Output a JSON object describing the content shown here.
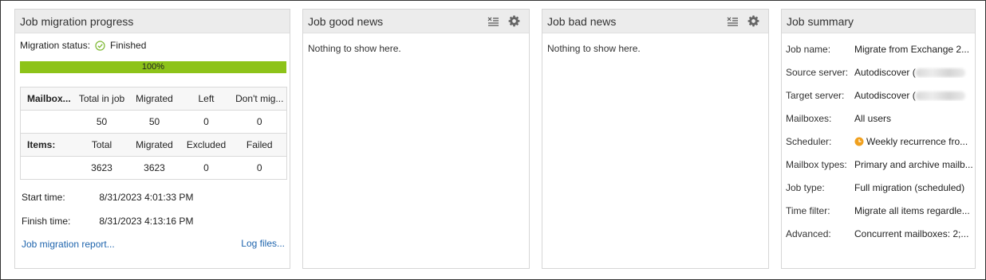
{
  "migration": {
    "title": "Job migration progress",
    "status_label": "Migration status:",
    "status_value": "Finished",
    "progress_fraction": 1.0,
    "progress_text": "100%",
    "mailbox_header": [
      "Mailbox...",
      "Total in job",
      "Migrated",
      "Left",
      "Don't mig..."
    ],
    "mailbox_values": [
      "",
      "50",
      "50",
      "0",
      "0"
    ],
    "items_header": [
      "Items:",
      "Total",
      "Migrated",
      "Excluded",
      "Failed"
    ],
    "items_values": [
      "",
      "3623",
      "3623",
      "0",
      "0"
    ],
    "start_label": "Start time:",
    "start_value": "8/31/2023 4:01:33 PM",
    "finish_label": "Finish time:",
    "finish_value": "8/31/2023 4:13:16 PM",
    "report_link": "Job migration report...",
    "log_link": "Log files..."
  },
  "good_news": {
    "title": "Job good news",
    "message": "Nothing to show here."
  },
  "bad_news": {
    "title": "Job bad news",
    "message": "Nothing to show here."
  },
  "summary": {
    "title": "Job summary",
    "rows": [
      {
        "label": "Job name:",
        "value": "Migrate from Exchange 2..."
      },
      {
        "label": "Source server:",
        "value": "Autodiscover ("
      },
      {
        "label": "Target server:",
        "value": "Autodiscover ("
      },
      {
        "label": "Mailboxes:",
        "value": "All users"
      },
      {
        "label": "Scheduler:",
        "value": "Weekly recurrence fro..."
      },
      {
        "label": "Mailbox types:",
        "value": "Primary and archive mailb..."
      },
      {
        "label": "Job type:",
        "value": "Full migration (scheduled)"
      },
      {
        "label": "Time filter:",
        "value": "Migrate all items regardle..."
      },
      {
        "label": "Advanced:",
        "value": "Concurrent mailboxes: 2;..."
      }
    ]
  },
  "colors": {
    "progress_fill": "#8dc319",
    "link": "#1e64ad",
    "success": "#7cb830",
    "scheduler_icon": "#f0a01e"
  }
}
